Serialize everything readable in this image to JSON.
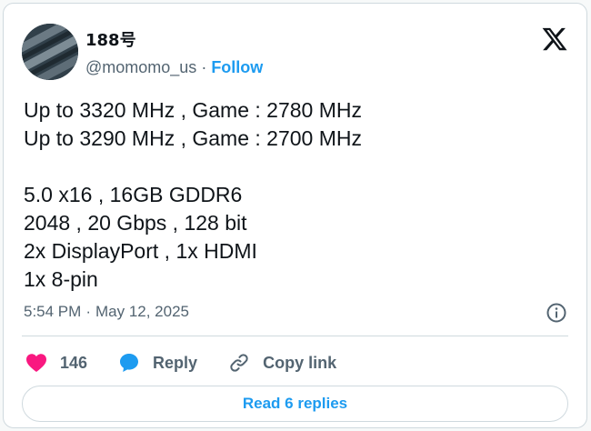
{
  "author": {
    "display_name": "188号",
    "handle": "@momomo_us",
    "separator": "·",
    "follow_label": "Follow"
  },
  "tweet": {
    "lines": [
      "Up to 3320 MHz , Game : 2780 MHz",
      "Up to 3290 MHz , Game : 2700 MHz",
      "",
      "5.0 x16 , 16GB GDDR6",
      "2048 , 20 Gbps , 128 bit",
      "2x DisplayPort , 1x HDMI",
      "1x 8-pin"
    ]
  },
  "meta": {
    "time": "5:54 PM",
    "separator": "·",
    "date": "May 12, 2025"
  },
  "actions": {
    "like_count": "146",
    "reply_label": "Reply",
    "copy_label": "Copy link"
  },
  "footer": {
    "read_replies_label": "Read 6 replies"
  },
  "icons": {
    "logo": "x-logo-icon",
    "info": "info-icon",
    "like": "heart-icon",
    "reply": "speech-bubble-icon",
    "copy": "link-icon"
  },
  "colors": {
    "accent": "#1d9bf0",
    "like": "#f91880",
    "secondary_text": "#536471",
    "primary_text": "#0f1419",
    "border": "#cfd9de"
  }
}
